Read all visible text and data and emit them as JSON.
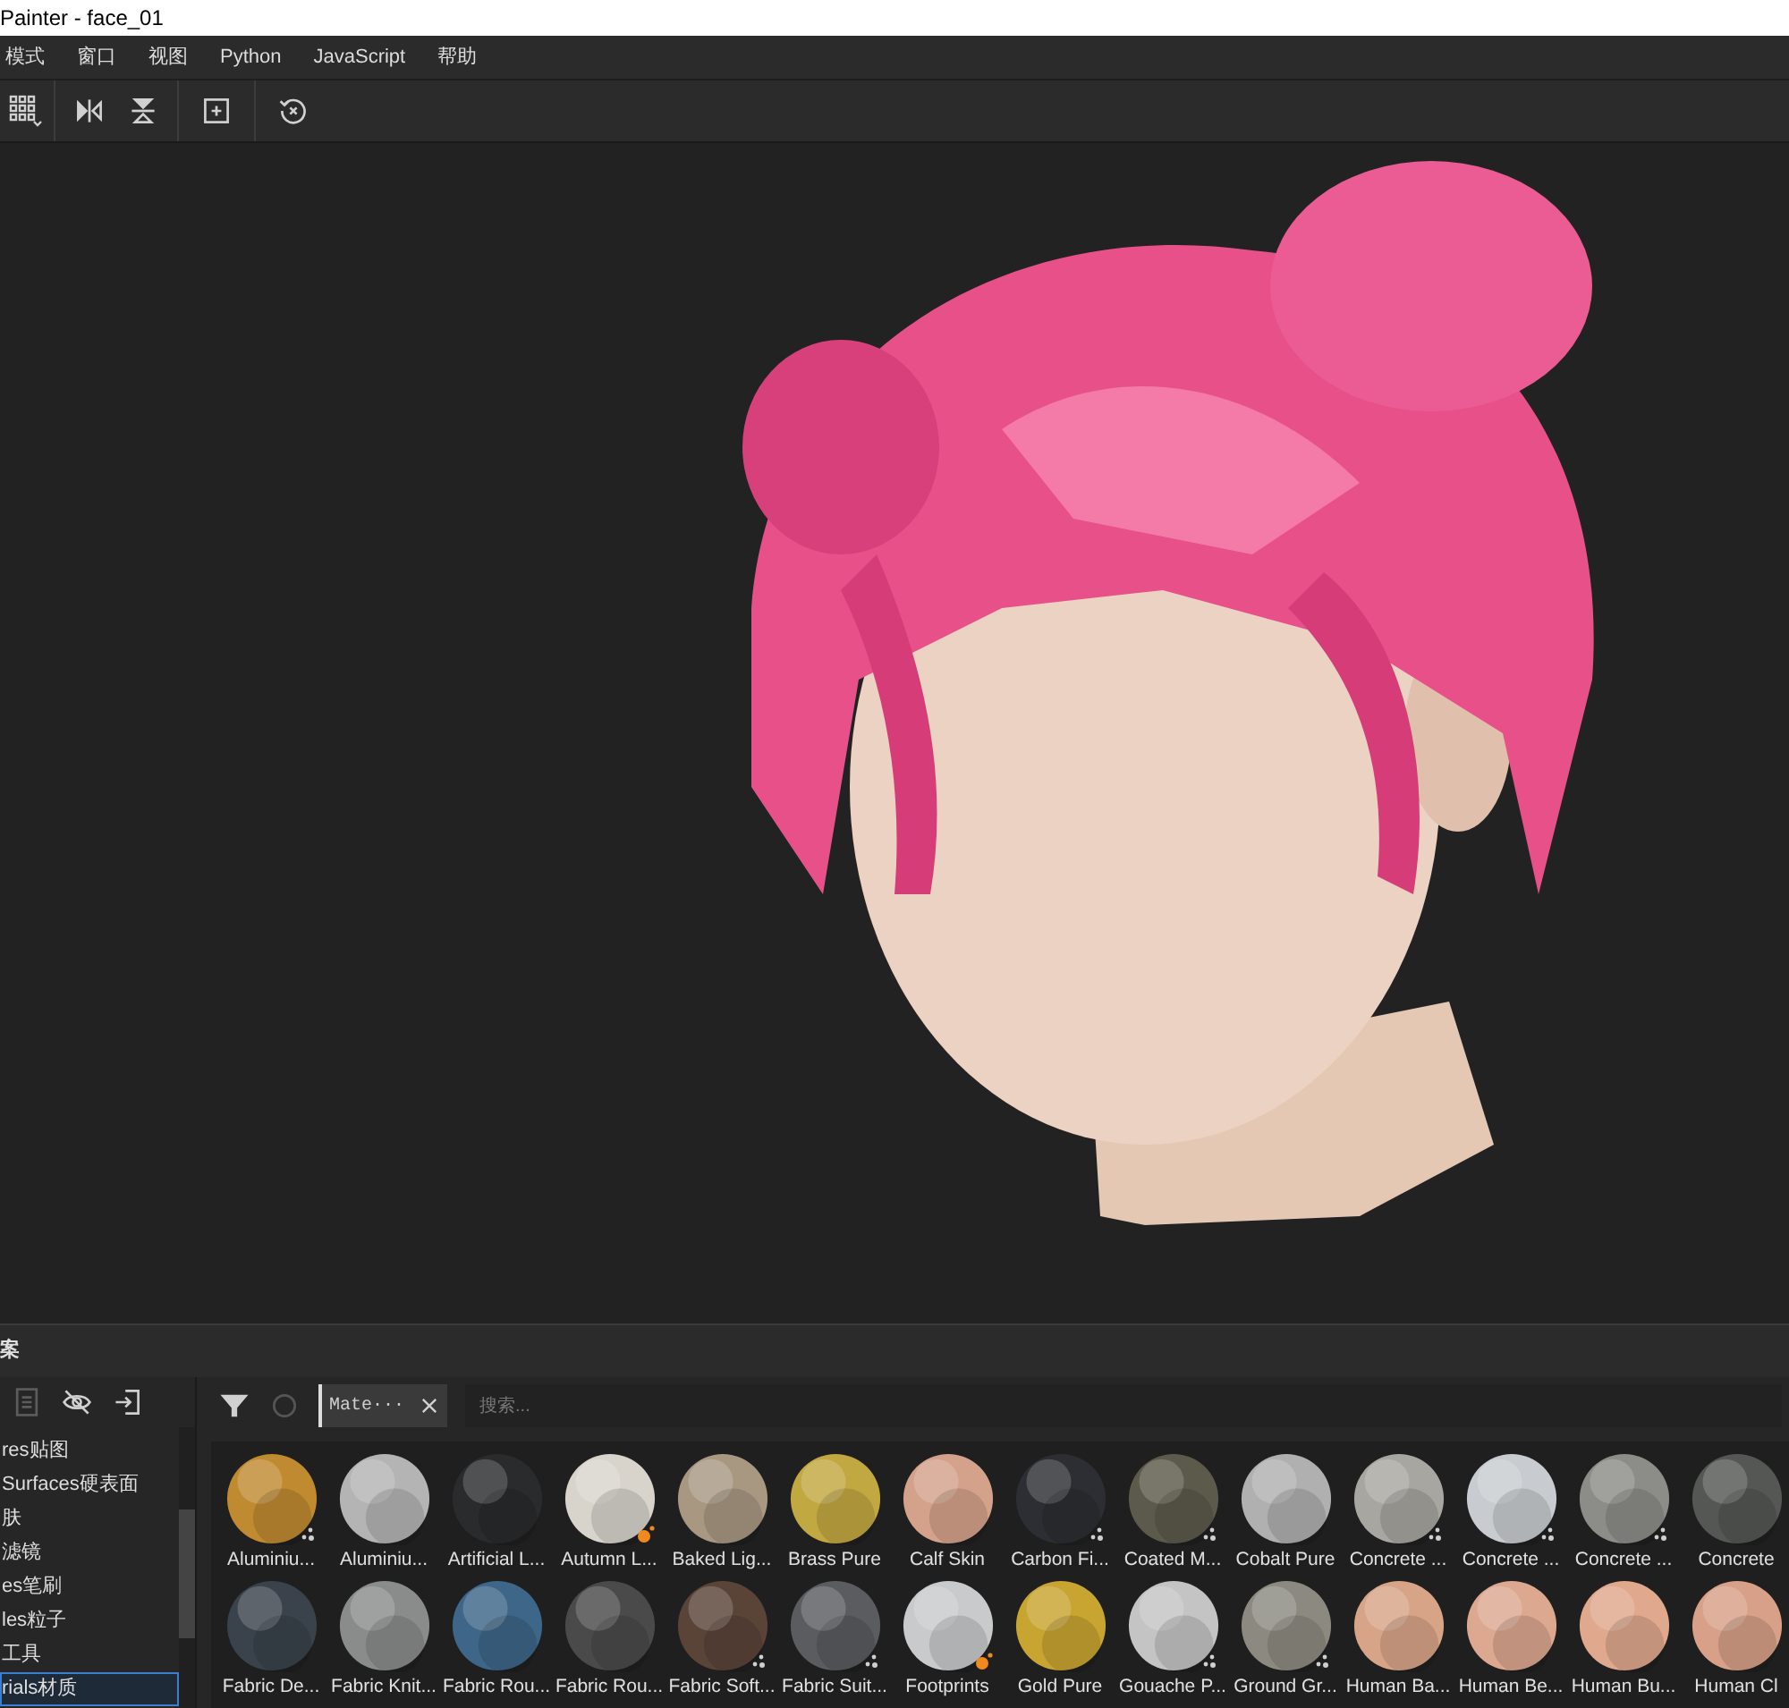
{
  "window": {
    "title": "Painter - face_01"
  },
  "menu": [
    "模式",
    "窗口",
    "视图",
    "Python",
    "JavaScript",
    "帮助"
  ],
  "shelf": {
    "title": "案",
    "categories": [
      {
        "label": "res贴图",
        "selected": false
      },
      {
        "label": "Surfaces硬表面",
        "selected": false
      },
      {
        "label": "肤",
        "selected": false
      },
      {
        "label": "滤镜",
        "selected": false
      },
      {
        "label": "es笔刷",
        "selected": false
      },
      {
        "label": "les粒子",
        "selected": false
      },
      {
        "label": "工具",
        "selected": false
      },
      {
        "label": "rials材质",
        "selected": true
      }
    ],
    "filter_tag": "Mate···",
    "search": {
      "placeholder": "搜索..."
    },
    "materials": [
      {
        "name": "Aluminiu...",
        "color": "#c08a30",
        "kind": "dots"
      },
      {
        "name": "Aluminiu...",
        "color": "#b4b4b4",
        "kind": "plain"
      },
      {
        "name": "Artificial L...",
        "color": "#2a2b2d",
        "kind": "plain"
      },
      {
        "name": "Autumn L...",
        "color": "#d8d4cc",
        "kind": "flame"
      },
      {
        "name": "Baked Lig...",
        "color": "#a89882",
        "kind": "plain"
      },
      {
        "name": "Brass Pure",
        "color": "#c2a840",
        "kind": "plain"
      },
      {
        "name": "Calf Skin",
        "color": "#d4a28a",
        "kind": "plain"
      },
      {
        "name": "Carbon Fi...",
        "color": "#2c2e33",
        "kind": "dots"
      },
      {
        "name": "Coated M...",
        "color": "#5c5a4a",
        "kind": "dots"
      },
      {
        "name": "Cobalt Pure",
        "color": "#b0b0b0",
        "kind": "plain"
      },
      {
        "name": "Concrete ...",
        "color": "#a8a6a0",
        "kind": "dots"
      },
      {
        "name": "Concrete ...",
        "color": "#c8ccd0",
        "kind": "dots"
      },
      {
        "name": "Concrete ...",
        "color": "#8c8c88",
        "kind": "dots"
      },
      {
        "name": "Concrete",
        "color": "#555755",
        "kind": "plain"
      },
      {
        "name": "Fabric De...",
        "color": "#3a424c",
        "kind": "plain"
      },
      {
        "name": "Fabric Knit...",
        "color": "#8a8c8c",
        "kind": "plain"
      },
      {
        "name": "Fabric Rou...",
        "color": "#3e6688",
        "kind": "plain"
      },
      {
        "name": "Fabric Rou...",
        "color": "#4a4a4a",
        "kind": "plain"
      },
      {
        "name": "Fabric Soft...",
        "color": "#5a4438",
        "kind": "dots"
      },
      {
        "name": "Fabric Suit...",
        "color": "#5a5c60",
        "kind": "dots"
      },
      {
        "name": "Footprints",
        "color": "#c8cacc",
        "kind": "flame"
      },
      {
        "name": "Gold Pure",
        "color": "#c8a430",
        "kind": "plain"
      },
      {
        "name": "Gouache P...",
        "color": "#c4c4c4",
        "kind": "dots"
      },
      {
        "name": "Ground Gr...",
        "color": "#8c8a80",
        "kind": "dots"
      },
      {
        "name": "Human Ba...",
        "color": "#d8a488",
        "kind": "plain"
      },
      {
        "name": "Human Be...",
        "color": "#dca890",
        "kind": "plain"
      },
      {
        "name": "Human Bu...",
        "color": "#e0a88c",
        "kind": "plain"
      },
      {
        "name": "Human Cl",
        "color": "#d8a088",
        "kind": "plain"
      }
    ]
  }
}
